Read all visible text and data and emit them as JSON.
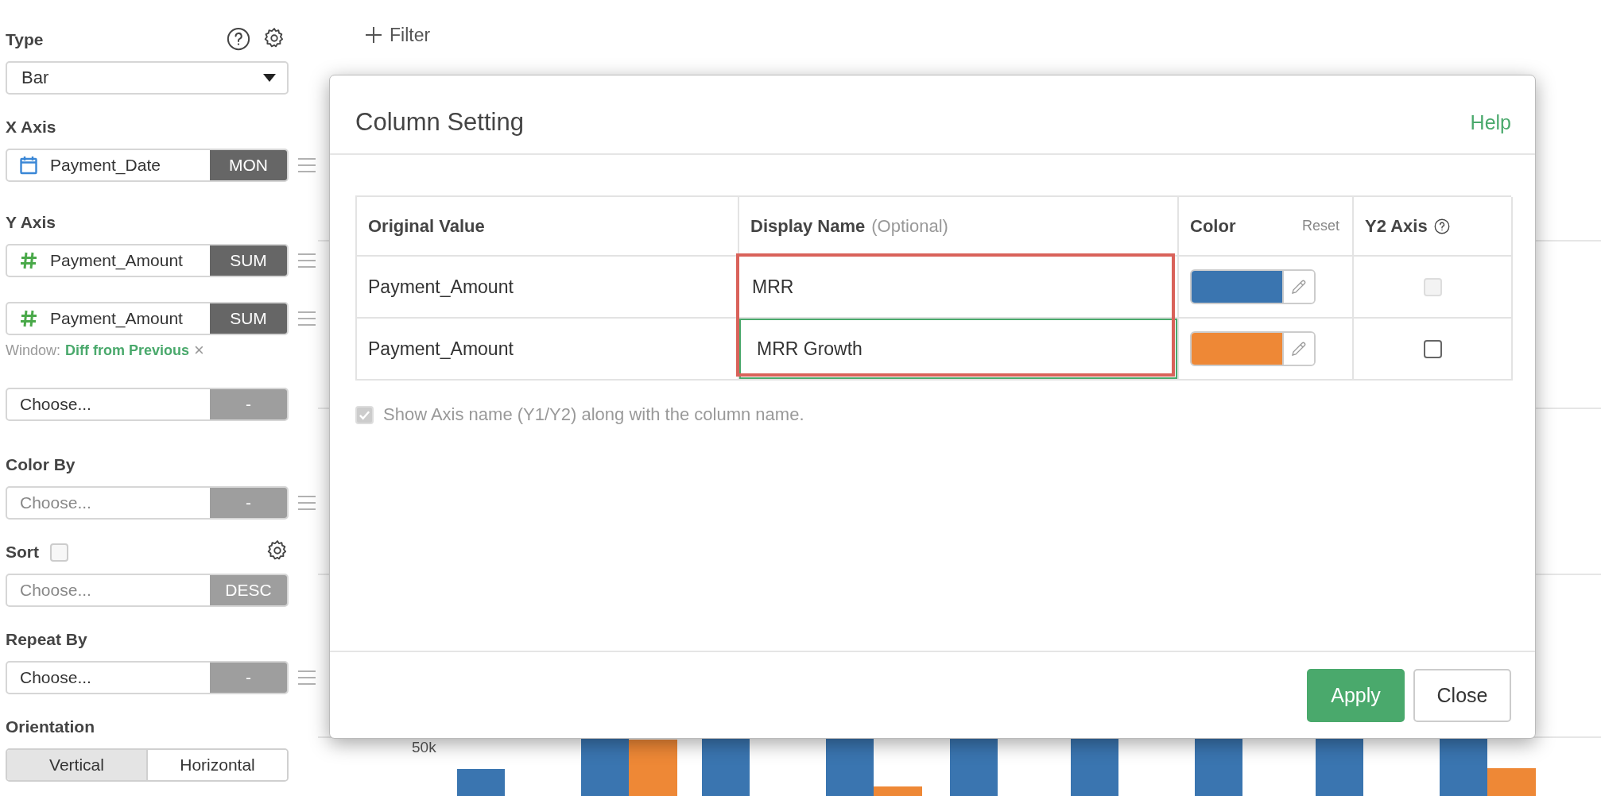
{
  "sidebar": {
    "type": {
      "label": "Type",
      "value": "Bar"
    },
    "x_axis": {
      "label": "X Axis",
      "fields": [
        {
          "kind": "date",
          "name": "Payment_Date",
          "aggregation": "MON",
          "enabled": true,
          "draggable": true
        }
      ]
    },
    "y_axis": {
      "label": "Y Axis",
      "fields": [
        {
          "kind": "number",
          "name": "Payment_Amount",
          "aggregation": "SUM",
          "enabled": true,
          "draggable": true
        },
        {
          "kind": "number",
          "name": "Payment_Amount",
          "aggregation": "SUM",
          "enabled": true,
          "draggable": true,
          "window_label": "Window:",
          "window_value": "Diff from Previous",
          "window_remove": "×"
        },
        {
          "name": "Choose...",
          "aggregation": "-",
          "enabled": false,
          "draggable": false
        }
      ]
    },
    "color_by": {
      "label": "Color By",
      "field": {
        "placeholder": "Choose...",
        "aggregation": "-",
        "enabled": false,
        "draggable": true
      }
    },
    "sort": {
      "label": "Sort",
      "checked": false,
      "field": {
        "placeholder": "Choose...",
        "aggregation": "DESC",
        "enabled": false,
        "draggable": false
      }
    },
    "repeat_by": {
      "label": "Repeat By",
      "field": {
        "name": "Choose...",
        "aggregation": "-",
        "enabled": false,
        "draggable": true
      }
    },
    "orientation": {
      "label": "Orientation",
      "options": [
        {
          "label": "Vertical",
          "selected": true
        },
        {
          "label": "Horizontal",
          "selected": false
        }
      ]
    }
  },
  "toolbar": {
    "filter": "Filter"
  },
  "chart": {
    "ytick_label": "50k"
  },
  "dialog": {
    "title": "Column Setting",
    "help": "Help",
    "columns": [
      {
        "kind": "plain",
        "label": "Original Value"
      },
      {
        "kind": "hint",
        "label": "Display Name",
        "hint": "(Optional)"
      },
      {
        "kind": "action",
        "label": "Color",
        "action": "Reset"
      },
      {
        "kind": "help",
        "label": "Y2 Axis"
      }
    ],
    "rows": [
      {
        "original": "Payment_Amount",
        "display": "MRR",
        "focused": false,
        "color": "#3a75b0",
        "y2_checked": false,
        "y2_disabled": true
      },
      {
        "original": "Payment_Amount",
        "display": "MRR Growth",
        "focused": true,
        "color": "#ee8836",
        "y2_checked": false,
        "y2_disabled": false
      }
    ],
    "highlight_display_column": true,
    "show_axis_name": {
      "label": "Show Axis name (Y1/Y2) along with the column name.",
      "checked": true,
      "disabled": true
    },
    "buttons": [
      {
        "kind": "primary",
        "label": "Apply"
      },
      {
        "kind": "default",
        "label": "Close"
      }
    ]
  }
}
